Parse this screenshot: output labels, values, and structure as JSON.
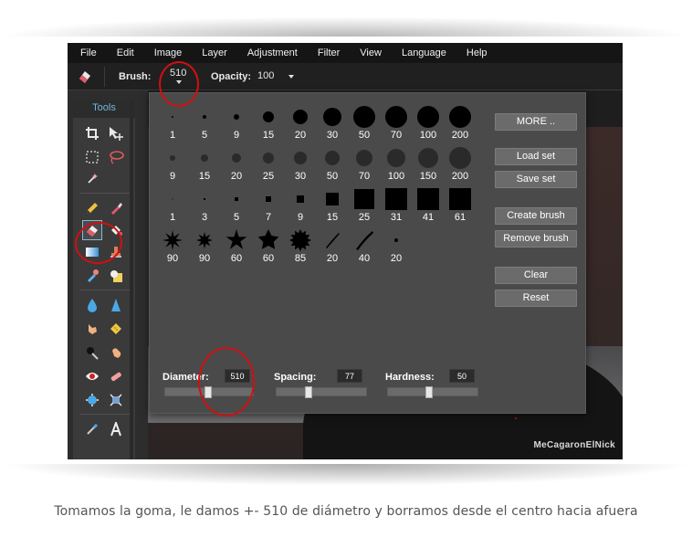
{
  "menubar": {
    "items": [
      "File",
      "Edit",
      "Image",
      "Layer",
      "Adjustment",
      "Filter",
      "View",
      "Language",
      "Help"
    ]
  },
  "options": {
    "brush_label": "Brush:",
    "brush_value": "510",
    "opacity_label": "Opacity:",
    "opacity_value": "100"
  },
  "tools": {
    "title": "Tools"
  },
  "brush_panel": {
    "rows": [
      {
        "style": "soft-small",
        "sizes": [
          "1",
          "5",
          "9",
          "15",
          "20",
          "30",
          "50",
          "70",
          "100",
          "200"
        ]
      },
      {
        "style": "soft",
        "sizes": [
          "9",
          "15",
          "20",
          "25",
          "30",
          "50",
          "70",
          "100",
          "150",
          "200"
        ]
      },
      {
        "style": "square",
        "sizes": [
          "1",
          "3",
          "5",
          "7",
          "9",
          "15",
          "25",
          "31",
          "41",
          "61"
        ]
      },
      {
        "style": "shapes",
        "sizes": [
          "90",
          "90",
          "60",
          "60",
          "85",
          "20",
          "40",
          "20"
        ]
      }
    ],
    "buttons": {
      "more": "MORE ..",
      "load_set": "Load set",
      "save_set": "Save set",
      "create_brush": "Create brush",
      "remove_brush": "Remove brush",
      "clear": "Clear",
      "reset": "Reset"
    },
    "diameter": {
      "label": "Diameter:",
      "value": "510",
      "level": 0.49
    },
    "spacing": {
      "label": "Spacing:",
      "value": "77",
      "level": 0.35
    },
    "hardness": {
      "label": "Hardness:",
      "value": "50",
      "level": 0.46
    }
  },
  "canvas": {
    "watermark": "MeCagaronElNick"
  },
  "caption": "Tomamos la goma, le damos +- 510 de diámetro y borramos desde el centro hacia afuera",
  "colors": {
    "annotation": "#d01010",
    "tools_title": "#6fb8e0"
  }
}
